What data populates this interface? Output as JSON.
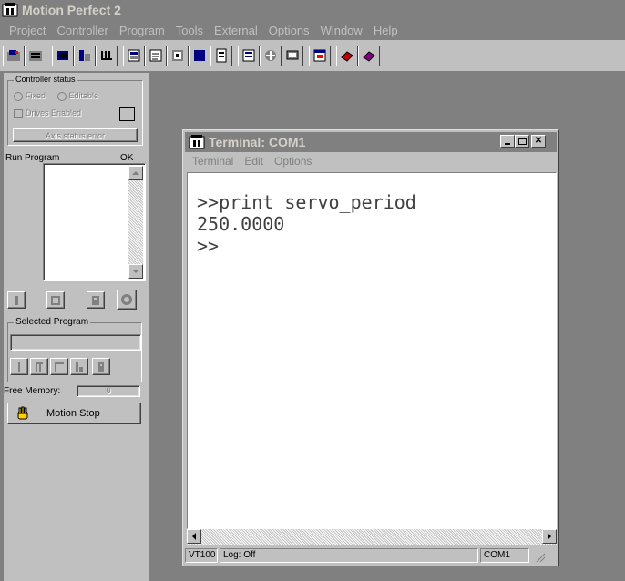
{
  "app": {
    "title": "Motion Perfect 2",
    "menu": [
      "Project",
      "Controller",
      "Program",
      "Tools",
      "External",
      "Options",
      "Window",
      "Help"
    ]
  },
  "toolbar": {
    "buttons": [
      "connect",
      "disconnect",
      "terminal",
      "axis-params",
      "io-status",
      "jog",
      "oscilloscope",
      "reset",
      "table",
      "intelligent-drive",
      "program",
      "directory",
      "watch",
      "backup",
      "restore"
    ]
  },
  "left_panel": {
    "controller_status": {
      "legend": "Controller status",
      "radio_fixed": "Fixed",
      "radio_editable": "Editable",
      "drives_enabled": "Drives Enabled",
      "axis_status_button": "Axis status error"
    },
    "program_list": {
      "col_run": "Run",
      "col_program": "Program",
      "col_ok": "OK"
    },
    "selected_program": {
      "legend": "Selected Program",
      "value": ""
    },
    "free_memory_label": "Free Memory:",
    "free_memory_value": "0",
    "motion_stop_label": "Motion Stop"
  },
  "terminal": {
    "title": "Terminal: COM1",
    "menu": [
      "Terminal",
      "Edit",
      "Options"
    ],
    "lines": [
      ">>print servo_period",
      "250.0000",
      ">>"
    ],
    "status": {
      "mode": "VT100",
      "log": "Log: Off",
      "port": "COM1"
    }
  },
  "colors": {
    "face": "#c0c0c0",
    "inactive_title": "#808080",
    "desktop": "#808080"
  }
}
